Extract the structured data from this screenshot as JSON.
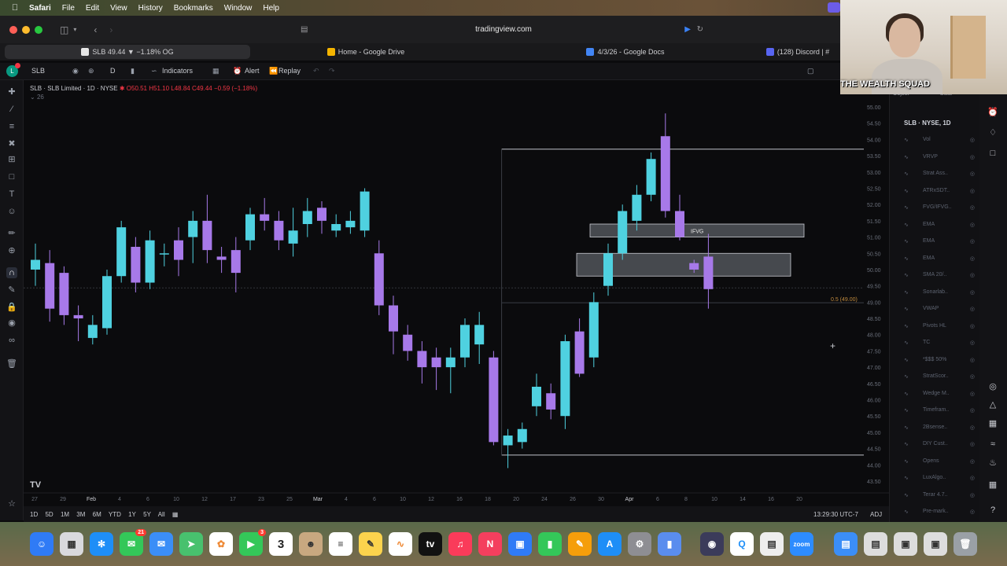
{
  "menubar": {
    "app": "Safari",
    "items": [
      "File",
      "Edit",
      "View",
      "History",
      "Bookmarks",
      "Window",
      "Help"
    ]
  },
  "safari": {
    "url": "tradingview.com",
    "tabs": [
      {
        "label": "SLB 49.44 ▼ −1.18% OG",
        "color": "#e6e6e6"
      },
      {
        "label": "Home - Google Drive",
        "color": "#f4b400"
      },
      {
        "label": "4/3/26 - Google Docs",
        "color": "#4285f4"
      },
      {
        "label": "(128) Discord | #",
        "color": "#5865f2"
      }
    ]
  },
  "tv_toolbar": {
    "avatar": "L",
    "symbol": "SLB",
    "interval": "D",
    "indicators": "Indicators",
    "alert": "Alert",
    "replay": "Replay"
  },
  "legend": {
    "title": "SLB · SLB Limited · 1D · NYSE",
    "ohlc": "O50.51 H51.10 L48.84 C49.44 −0.59 (−1.18%)",
    "sub": "26"
  },
  "chart_data": {
    "type": "candlestick",
    "ylim": [
      43.5,
      55.0
    ],
    "y_ticks": [
      "55.00",
      "54.50",
      "54.00",
      "53.50",
      "53.00",
      "52.50",
      "52.00",
      "51.50",
      "51.00",
      "50.50",
      "50.00",
      "49.50",
      "49.00",
      "48.50",
      "48.00",
      "47.50",
      "47.00",
      "46.50",
      "46.00",
      "45.50",
      "45.00",
      "44.50",
      "44.00",
      "43.50"
    ],
    "x_ticks": [
      "27",
      "29",
      "Feb",
      "4",
      "6",
      "10",
      "12",
      "17",
      "23",
      "25",
      "Mar",
      "4",
      "6",
      "10",
      "12",
      "16",
      "18",
      "20",
      "24",
      "26",
      "30",
      "Apr",
      "6",
      "8",
      "10",
      "14",
      "16",
      "20"
    ],
    "last_price": "49.44",
    "candles": [
      {
        "o": 50.0,
        "c": 50.3,
        "h": 50.8,
        "l": 49.5
      },
      {
        "o": 50.2,
        "c": 48.8,
        "h": 50.6,
        "l": 48.4
      },
      {
        "o": 49.9,
        "c": 48.6,
        "h": 50.1,
        "l": 48.3
      },
      {
        "o": 48.6,
        "c": 48.5,
        "h": 48.9,
        "l": 47.8
      },
      {
        "o": 47.9,
        "c": 48.3,
        "h": 48.6,
        "l": 47.7
      },
      {
        "o": 48.2,
        "c": 49.8,
        "h": 50.0,
        "l": 48.0
      },
      {
        "o": 49.8,
        "c": 51.3,
        "h": 51.5,
        "l": 49.6
      },
      {
        "o": 50.7,
        "c": 49.6,
        "h": 51.0,
        "l": 49.3
      },
      {
        "o": 49.6,
        "c": 50.9,
        "h": 51.2,
        "l": 49.4
      },
      {
        "o": 50.5,
        "c": 50.5,
        "h": 50.8,
        "l": 50.1
      },
      {
        "o": 50.9,
        "c": 50.3,
        "h": 51.3,
        "l": 49.8
      },
      {
        "o": 51.0,
        "c": 51.5,
        "h": 51.8,
        "l": 50.2
      },
      {
        "o": 51.5,
        "c": 50.6,
        "h": 52.3,
        "l": 50.2
      },
      {
        "o": 50.4,
        "c": 50.3,
        "h": 50.7,
        "l": 49.9
      },
      {
        "o": 50.6,
        "c": 49.9,
        "h": 51.0,
        "l": 49.3
      },
      {
        "o": 50.9,
        "c": 51.7,
        "h": 51.9,
        "l": 50.6
      },
      {
        "o": 51.7,
        "c": 51.5,
        "h": 52.2,
        "l": 51.2
      },
      {
        "o": 51.5,
        "c": 50.9,
        "h": 51.8,
        "l": 50.6
      },
      {
        "o": 50.8,
        "c": 51.2,
        "h": 51.9,
        "l": 50.4
      },
      {
        "o": 51.4,
        "c": 51.8,
        "h": 52.2,
        "l": 51.0
      },
      {
        "o": 51.9,
        "c": 51.5,
        "h": 52.1,
        "l": 51.1
      },
      {
        "o": 51.2,
        "c": 51.4,
        "h": 51.7,
        "l": 51.0
      },
      {
        "o": 51.3,
        "c": 51.5,
        "h": 51.8,
        "l": 51.1
      },
      {
        "o": 51.2,
        "c": 52.4,
        "h": 52.5,
        "l": 51.0
      },
      {
        "o": 50.5,
        "c": 48.9,
        "h": 50.9,
        "l": 48.6
      },
      {
        "o": 48.9,
        "c": 48.1,
        "h": 49.2,
        "l": 47.4
      },
      {
        "o": 48.0,
        "c": 47.5,
        "h": 48.3,
        "l": 47.2
      },
      {
        "o": 47.5,
        "c": 47.0,
        "h": 47.8,
        "l": 46.5
      },
      {
        "o": 47.3,
        "c": 47.0,
        "h": 47.6,
        "l": 46.3
      },
      {
        "o": 47.0,
        "c": 47.3,
        "h": 47.6,
        "l": 46.2
      },
      {
        "o": 47.3,
        "c": 48.3,
        "h": 48.5,
        "l": 47.0
      },
      {
        "o": 47.7,
        "c": 48.3,
        "h": 48.7,
        "l": 47.1
      },
      {
        "o": 47.3,
        "c": 44.7,
        "h": 47.5,
        "l": 44.6
      },
      {
        "o": 44.6,
        "c": 44.9,
        "h": 45.1,
        "l": 43.9
      },
      {
        "o": 44.7,
        "c": 45.1,
        "h": 45.3,
        "l": 44.5
      },
      {
        "o": 45.8,
        "c": 46.4,
        "h": 46.8,
        "l": 45.5
      },
      {
        "o": 46.2,
        "c": 45.7,
        "h": 46.5,
        "l": 45.4
      },
      {
        "o": 45.5,
        "c": 47.8,
        "h": 48.0,
        "l": 45.1
      },
      {
        "o": 48.1,
        "c": 46.8,
        "h": 48.5,
        "l": 46.7
      },
      {
        "o": 47.3,
        "c": 49.0,
        "h": 49.3,
        "l": 47.0
      },
      {
        "o": 49.5,
        "c": 50.5,
        "h": 50.8,
        "l": 49.2
      },
      {
        "o": 50.5,
        "c": 51.8,
        "h": 52.0,
        "l": 50.3
      },
      {
        "o": 51.5,
        "c": 52.3,
        "h": 52.6,
        "l": 51.2
      },
      {
        "o": 52.3,
        "c": 53.4,
        "h": 53.6,
        "l": 52.1
      },
      {
        "o": 54.1,
        "c": 51.8,
        "h": 54.8,
        "l": 51.6
      },
      {
        "o": 51.8,
        "c": 51.0,
        "h": 52.3,
        "l": 50.9
      },
      {
        "o": 50.2,
        "c": 50.0,
        "h": 50.3,
        "l": 49.9
      },
      {
        "o": 50.4,
        "c": 49.4,
        "h": 51.1,
        "l": 48.8
      }
    ],
    "zones": [
      {
        "label": "IFVG",
        "y0": 51.4,
        "y1": 51.0
      },
      {
        "label": "",
        "y0": 50.5,
        "y1": 49.8
      }
    ],
    "fib_label": "0.5 (49.00)",
    "range_box": {
      "top": 53.7,
      "bottom": 44.3
    }
  },
  "bottom": {
    "ranges": [
      "1D",
      "5D",
      "1M",
      "3M",
      "6M",
      "YTD",
      "1Y",
      "5Y",
      "All"
    ],
    "clock": "13:29:30 UTC-7",
    "adj": "ADJ"
  },
  "right_panel": {
    "header": [
      "Object",
      "Data"
    ],
    "title": "SLB · NYSE, 1D",
    "indicators": [
      "Vol",
      "VRVP",
      "Strat Ass..",
      "ATRxSDT..",
      "FVG/IFVG..",
      "EMA",
      "EMA",
      "EMA",
      "SMA 20/..",
      "Sonarlab..",
      "VWAP",
      "Pivots HL",
      "TC",
      "*$$$ 50%",
      "StratScor..",
      "Wedge M..",
      "Timefram..",
      "2Bsense..",
      "DIY Cust..",
      "Opens",
      "LuxAlgo..",
      "Terar 4.7..",
      "Pre-mark.."
    ]
  },
  "webcam": {
    "label": "THE WEALTH SQUAD"
  },
  "dock": {
    "calendar_day": "3",
    "messages_badge": "21",
    "facetime_badge": "3",
    "zoom_label": "zoom"
  }
}
